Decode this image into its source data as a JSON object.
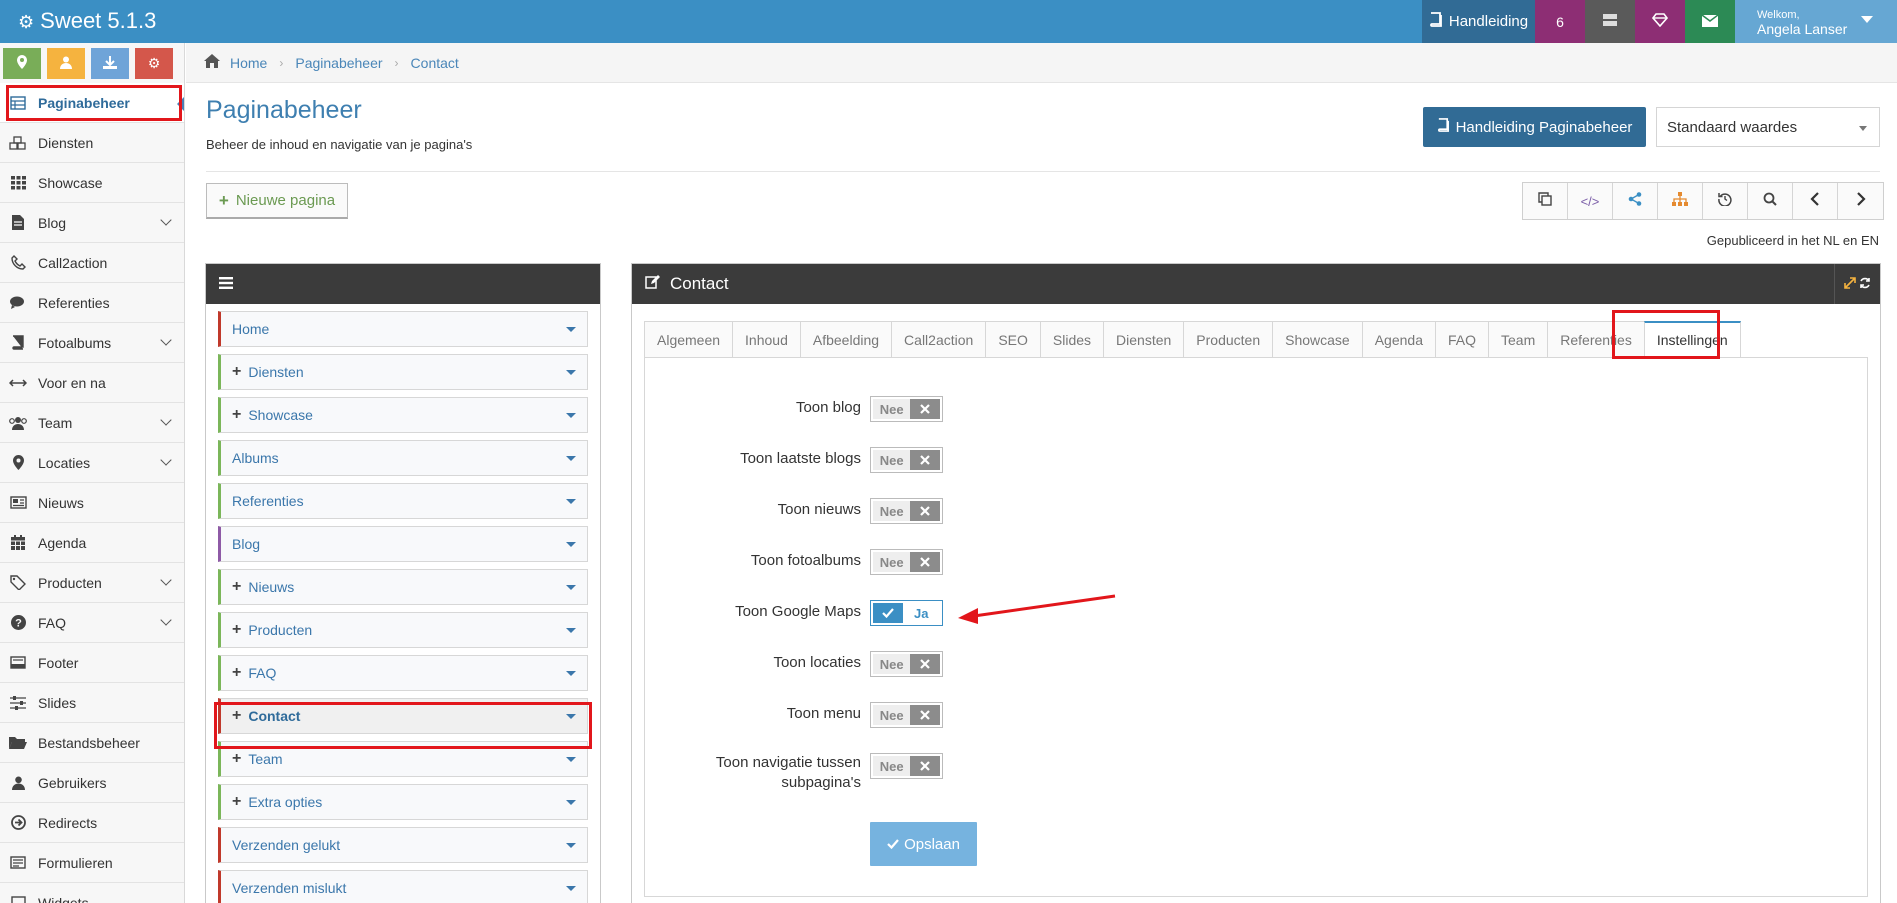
{
  "app": {
    "title": "Sweet 5.1.3"
  },
  "topbar": {
    "manual_label": "Handleiding",
    "notification_count": "6",
    "welcome": "Welkom,",
    "user_name": "Angela Lanser"
  },
  "sidebar": {
    "items": [
      {
        "label": "Paginabeheer",
        "icon": "table-icon",
        "expandable": false,
        "active": true
      },
      {
        "label": "Diensten",
        "icon": "cubes-icon",
        "expandable": false
      },
      {
        "label": "Showcase",
        "icon": "grid-icon",
        "expandable": false
      },
      {
        "label": "Blog",
        "icon": "file-icon",
        "expandable": true
      },
      {
        "label": "Call2action",
        "icon": "phone-icon",
        "expandable": false
      },
      {
        "label": "Referenties",
        "icon": "comments-icon",
        "expandable": false
      },
      {
        "label": "Fotoalbums",
        "icon": "book-icon",
        "expandable": true
      },
      {
        "label": "Voor en na",
        "icon": "arrows-h-icon",
        "expandable": false
      },
      {
        "label": "Team",
        "icon": "users-icon",
        "expandable": true
      },
      {
        "label": "Locaties",
        "icon": "map-marker-icon",
        "expandable": true
      },
      {
        "label": "Nieuws",
        "icon": "newspaper-icon",
        "expandable": false
      },
      {
        "label": "Agenda",
        "icon": "calendar-icon",
        "expandable": false
      },
      {
        "label": "Producten",
        "icon": "tags-icon",
        "expandable": true
      },
      {
        "label": "FAQ",
        "icon": "question-icon",
        "expandable": true
      },
      {
        "label": "Footer",
        "icon": "footer-icon",
        "expandable": false
      },
      {
        "label": "Slides",
        "icon": "sliders-icon",
        "expandable": false
      },
      {
        "label": "Bestandsbeheer",
        "icon": "folder-open-icon",
        "expandable": false
      },
      {
        "label": "Gebruikers",
        "icon": "user-icon",
        "expandable": false
      },
      {
        "label": "Redirects",
        "icon": "arrow-circle-icon",
        "expandable": false
      },
      {
        "label": "Formulieren",
        "icon": "form-icon",
        "expandable": false
      },
      {
        "label": "Widgets",
        "icon": "widget-icon",
        "expandable": false
      }
    ]
  },
  "breadcrumb": [
    "Home",
    "Paginabeheer",
    "Contact"
  ],
  "page": {
    "title": "Paginabeheer",
    "subtitle": "Beheer de inhoud en navigatie van je pagina's",
    "manual_button": "Handleiding Paginabeheer",
    "select_value": "Standaard waardes",
    "new_page_button": "Nieuwe pagina",
    "published_text": "Gepubliceerd in het NL en EN"
  },
  "tree": {
    "items": [
      {
        "label": "Home",
        "plus": false,
        "color": "red"
      },
      {
        "label": "Diensten",
        "plus": true,
        "color": "green"
      },
      {
        "label": "Showcase",
        "plus": true,
        "color": "green"
      },
      {
        "label": "Albums",
        "plus": false,
        "color": "green"
      },
      {
        "label": "Referenties",
        "plus": false,
        "color": "green"
      },
      {
        "label": "Blog",
        "plus": false,
        "color": "purple"
      },
      {
        "label": "Nieuws",
        "plus": true,
        "color": "green"
      },
      {
        "label": "Producten",
        "plus": true,
        "color": "green"
      },
      {
        "label": "FAQ",
        "plus": true,
        "color": "green"
      },
      {
        "label": "Contact",
        "plus": true,
        "color": "red",
        "selected": true
      },
      {
        "label": "Team",
        "plus": true,
        "color": "green"
      },
      {
        "label": "Extra opties",
        "plus": true,
        "color": "green"
      },
      {
        "label": "Verzenden gelukt",
        "plus": false,
        "color": "red"
      },
      {
        "label": "Verzenden mislukt",
        "plus": false,
        "color": "red"
      }
    ]
  },
  "editor": {
    "title": "Contact",
    "tabs": [
      "Algemeen",
      "Inhoud",
      "Afbeelding",
      "Call2action",
      "SEO",
      "Slides",
      "Diensten",
      "Producten",
      "Showcase",
      "Agenda",
      "FAQ",
      "Team",
      "Referenties",
      "Instellingen"
    ],
    "active_tab": "Instellingen",
    "settings": [
      {
        "label": "Toon blog",
        "value": "Nee",
        "on": false
      },
      {
        "label": "Toon laatste blogs",
        "value": "Nee",
        "on": false
      },
      {
        "label": "Toon nieuws",
        "value": "Nee",
        "on": false
      },
      {
        "label": "Toon fotoalbums",
        "value": "Nee",
        "on": false
      },
      {
        "label": "Toon Google Maps",
        "value": "Ja",
        "on": true
      },
      {
        "label": "Toon locaties",
        "value": "Nee",
        "on": false
      },
      {
        "label": "Toon menu",
        "value": "Nee",
        "on": false
      },
      {
        "label": "Toon navigatie tussen subpagina's",
        "value": "Nee",
        "on": false
      }
    ],
    "save_button": "Opslaan"
  },
  "colors": {
    "topbar": "#3b8fc4",
    "accent": "#316b95",
    "highlight": "#e2161b"
  }
}
